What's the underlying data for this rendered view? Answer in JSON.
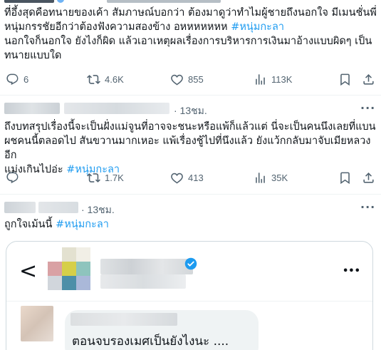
{
  "tweet1": {
    "line1": "ที่อึ้งสุดคือทนายของเค้า สัมภาษณ์บอกว่า ต้องมาดูว่าทำไมผู้ชายถึงนอกใจ มีเมนชั่นพี่",
    "line2_text": "หนุ่มกรรชัยอีกว่าต้องฟังความสองข้าง อหหหหหหห ",
    "line2_tag": "#หนุ่มกะลา",
    "line3": "นอกใจก็นอกใจ ยังไงก็ผิด แล้วเอาเหตุผลเรื่องการบริหารการเงินมาอ้างแบบผิดๆ เป็น",
    "line4": "ทนายแบบใด",
    "stats": {
      "replies": "6",
      "reposts": "4.6K",
      "likes": "855",
      "views": "113K"
    }
  },
  "tweet2": {
    "time": "· 13ชม.",
    "line1": "ถึงบทสรุปเรื่องนี้จะเป็นฝั่งแม่จูนที่อาจจะชนะหรือแพ้ก็แล้วแต่ นี่จะเป็นคนนึงเลยที่แบน",
    "line2": "ผชคนนี้ตลอดไป สันขวานมากเหอะ แพ้เรื่องชู้ไปที่นึงแล้ว ยังแว้กกลับมาจับเมียหลวงอีก",
    "line3_text": "แม่งเกินไปอ่ะ ",
    "line3_tag": "#หนุ่มกะลา",
    "stats": {
      "replies": "",
      "reposts": "1.7K",
      "likes": "413",
      "views": "35K"
    }
  },
  "tweet3": {
    "time": "· 13ชม.",
    "line1_text": "ถูกใจเม้นนี้ ",
    "line1_tag": "#หนุ่มกะลา",
    "card": {
      "back_symbol": "<",
      "more_symbol": "•••",
      "message": "ตอนจบรองเมศเป็นยังไงนะ ...."
    }
  },
  "more_symbol": "···",
  "colors": {
    "accent": "#1d9bf0",
    "muted": "#536471",
    "divider": "#eff3f4",
    "verified": "#1d9bf0"
  },
  "icons": {
    "reply": "reply-icon",
    "repost": "repost-icon",
    "like": "heart-icon",
    "views": "views-icon",
    "bookmark": "bookmark-icon",
    "share": "share-icon"
  }
}
